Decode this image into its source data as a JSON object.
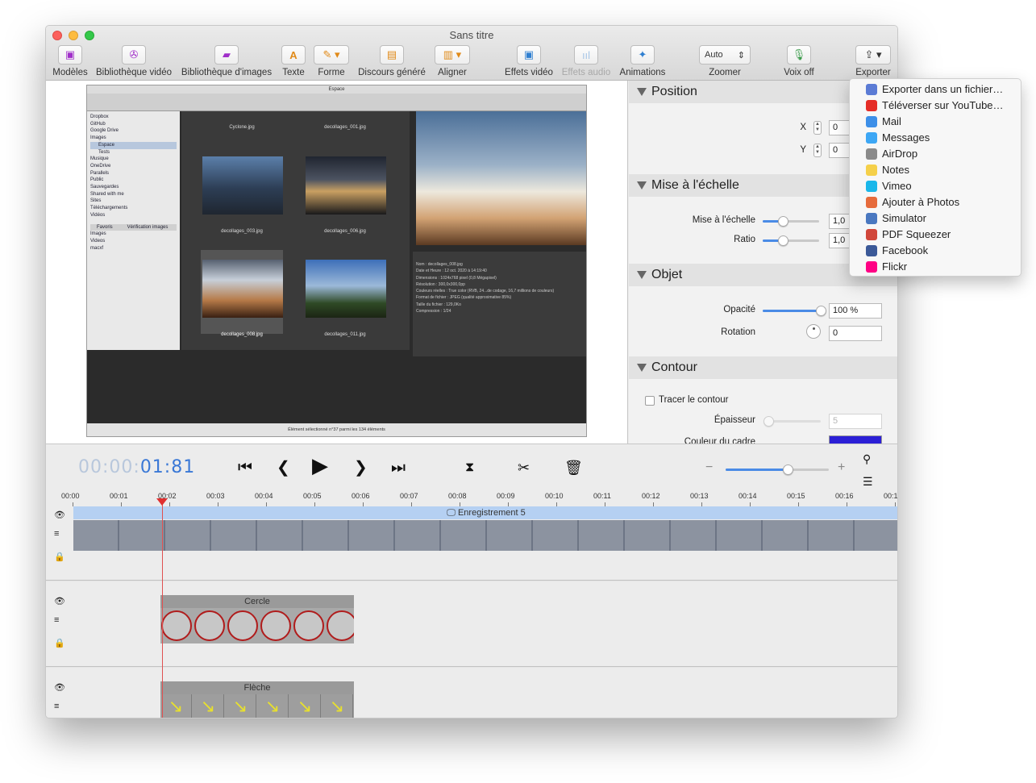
{
  "window": {
    "title": "Sans titre"
  },
  "toolbar": {
    "models": "Modèles",
    "video_library": "Bibliothèque vidéo",
    "image_library": "Bibliothèque d'images",
    "text": "Texte",
    "shape": "Forme",
    "generated_speech": "Discours généré",
    "align": "Aligner",
    "video_effects": "Effets vidéo",
    "audio_effects": "Effets audio",
    "animations": "Animations",
    "zoom_value": "Auto",
    "zoom": "Zoomer",
    "voice_over": "Voix off",
    "export": "Exporter"
  },
  "screenshot_preview": {
    "title": "Espace",
    "sidebar_items": [
      "Dropbox",
      "GitHub",
      "Google Drive",
      "Images",
      "Espace",
      "Tests",
      "Musique",
      "OneDrive",
      "Parallels",
      "Public",
      "Sauvegardes",
      "Shared with me",
      "Sites",
      "Téléchargements",
      "Vidéos"
    ],
    "favorites_tab": "Favoris",
    "verify_tab": "Vérification images",
    "favorites_items": [
      "Images",
      "Videos",
      "macxf"
    ],
    "thumbnails": [
      "Cyclone.jpg",
      "decollages_001.jpg",
      "decollages_003.jpg",
      "decollages_006.jpg",
      "decollages_008.jpg",
      "decollages_011.jpg"
    ],
    "info_lines": [
      "Nom : decollages_008.jpg",
      "Date et Heure : 12 oct. 2020 à 14:19:40",
      "Dimensions : 1024x768 pixel (0,8 Mégapixel)",
      "Résolution : 300,0x300,0pp",
      "Couleurs réelles : True color (RVB, 24...de codage, 16,7 millions de couleurs)",
      "Format de fichier : JPEG (qualité approximative 85%)",
      "Taille du fichier : 129,0Ko",
      "Compression : 1/24"
    ],
    "status": "Élément sélectionné n°37 parmi les 134 éléments"
  },
  "inspector": {
    "position": {
      "title": "Position",
      "x_label": "X",
      "x_value": "0",
      "y_label": "Y",
      "y_value": "0"
    },
    "scale": {
      "title": "Mise à l'échelle",
      "scale_label": "Mise à l'échelle",
      "scale_value": "1,0",
      "scale_level": 0.35,
      "ratio_label": "Ratio",
      "ratio_value": "1,0",
      "ratio_level": 0.35
    },
    "object": {
      "title": "Objet",
      "opacity_label": "Opacité",
      "opacity_value": "100 %",
      "opacity_level": 1.0,
      "rotation_label": "Rotation",
      "rotation_value": "0"
    },
    "outline": {
      "title": "Contour",
      "checkbox_label": "Tracer le contour",
      "thickness_label": "Épaisseur",
      "thickness_value": "5",
      "color_label": "Couleur du cadre",
      "color": "#2b1fd6"
    }
  },
  "transport": {
    "timecode_dim": "00:00:",
    "timecode_hi": "01:81",
    "zoom_level": 0.6
  },
  "ruler": [
    "00:00",
    "00:01",
    "00:02",
    "00:03",
    "00:04",
    "00:05",
    "00:06",
    "00:07",
    "00:08",
    "00:09",
    "00:10",
    "00:11",
    "00:12",
    "00:13",
    "00:14",
    "00:15",
    "00:16",
    "00:1"
  ],
  "tracks": {
    "recording": "Enregistrement 5",
    "circle": "Cercle",
    "arrow": "Flèche"
  },
  "export_menu": {
    "items": [
      {
        "label": "Exporter dans un fichier…",
        "icon": "file-icon",
        "color": "#5b7bd5"
      },
      {
        "label": "Téléverser sur YouTube…",
        "icon": "youtube-icon",
        "color": "#e52d27"
      },
      {
        "label": "Mail",
        "icon": "mail-icon",
        "color": "#3d8fe8"
      },
      {
        "label": "Messages",
        "icon": "messages-icon",
        "color": "#3da7f5"
      },
      {
        "label": "AirDrop",
        "icon": "airdrop-icon",
        "color": "#8a8a8a"
      },
      {
        "label": "Notes",
        "icon": "notes-icon",
        "color": "#f5d04a"
      },
      {
        "label": "Vimeo",
        "icon": "vimeo-icon",
        "color": "#1ab7ea"
      },
      {
        "label": "Ajouter à Photos",
        "icon": "photos-icon",
        "color": "#e66b3c"
      },
      {
        "label": "Simulator",
        "icon": "simulator-icon",
        "color": "#4a78c0"
      },
      {
        "label": "PDF Squeezer",
        "icon": "pdf-squeezer-icon",
        "color": "#d1473b"
      },
      {
        "label": "Facebook",
        "icon": "facebook-icon",
        "color": "#3b5998"
      },
      {
        "label": "Flickr",
        "icon": "flickr-icon",
        "color": "#ff0084"
      }
    ]
  }
}
